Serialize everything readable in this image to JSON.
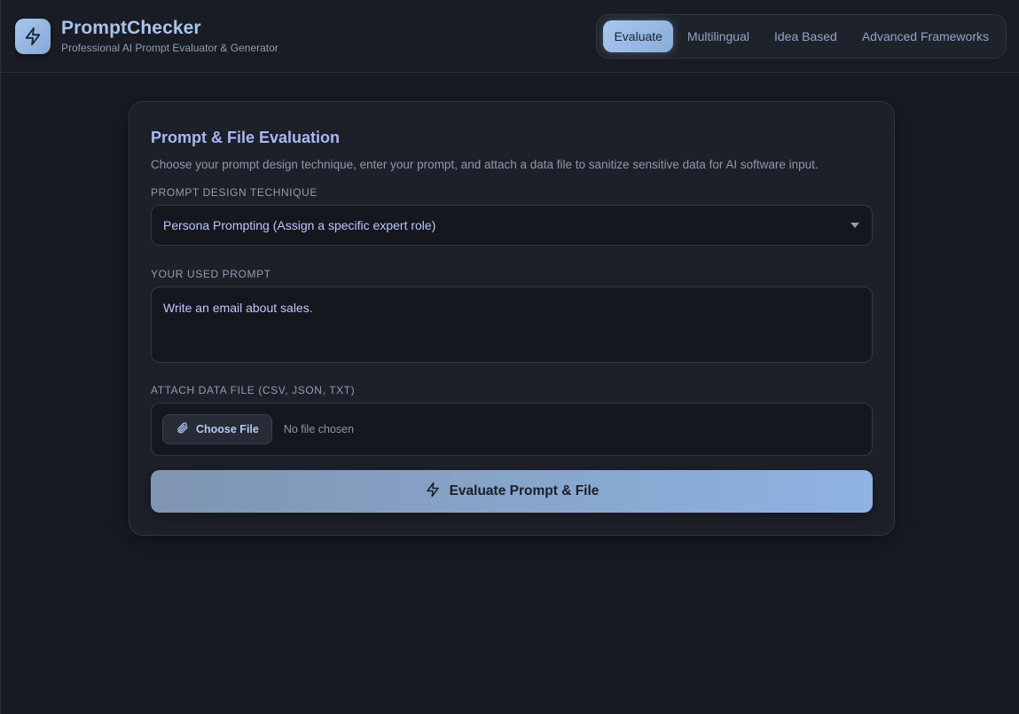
{
  "header": {
    "title": "PromptChecker",
    "subtitle": "Professional AI Prompt Evaluator & Generator",
    "logo_icon": "bolt-icon"
  },
  "tabs": [
    {
      "label": "Evaluate",
      "active": true
    },
    {
      "label": "Multilingual",
      "active": false
    },
    {
      "label": "Idea Based",
      "active": false
    },
    {
      "label": "Advanced Frameworks",
      "active": false
    }
  ],
  "card": {
    "title": "Prompt & File Evaluation",
    "description": "Choose your prompt design technique, enter your prompt, and attach a data file to sanitize sensitive data for AI software input.",
    "technique_label": "PROMPT DESIGN TECHNIQUE",
    "technique_value": "Persona Prompting (Assign a specific expert role)",
    "prompt_label": "YOUR USED PROMPT",
    "prompt_value": "Write an email about sales.",
    "file_label": "ATTACH DATA FILE (CSV, JSON, TXT)",
    "file_button": "Choose File",
    "file_status": "No file chosen",
    "evaluate_button": "Evaluate Prompt & File"
  },
  "colors": {
    "accent": "#a9c8ef",
    "background": "#171a21",
    "card": "#1d2029"
  }
}
